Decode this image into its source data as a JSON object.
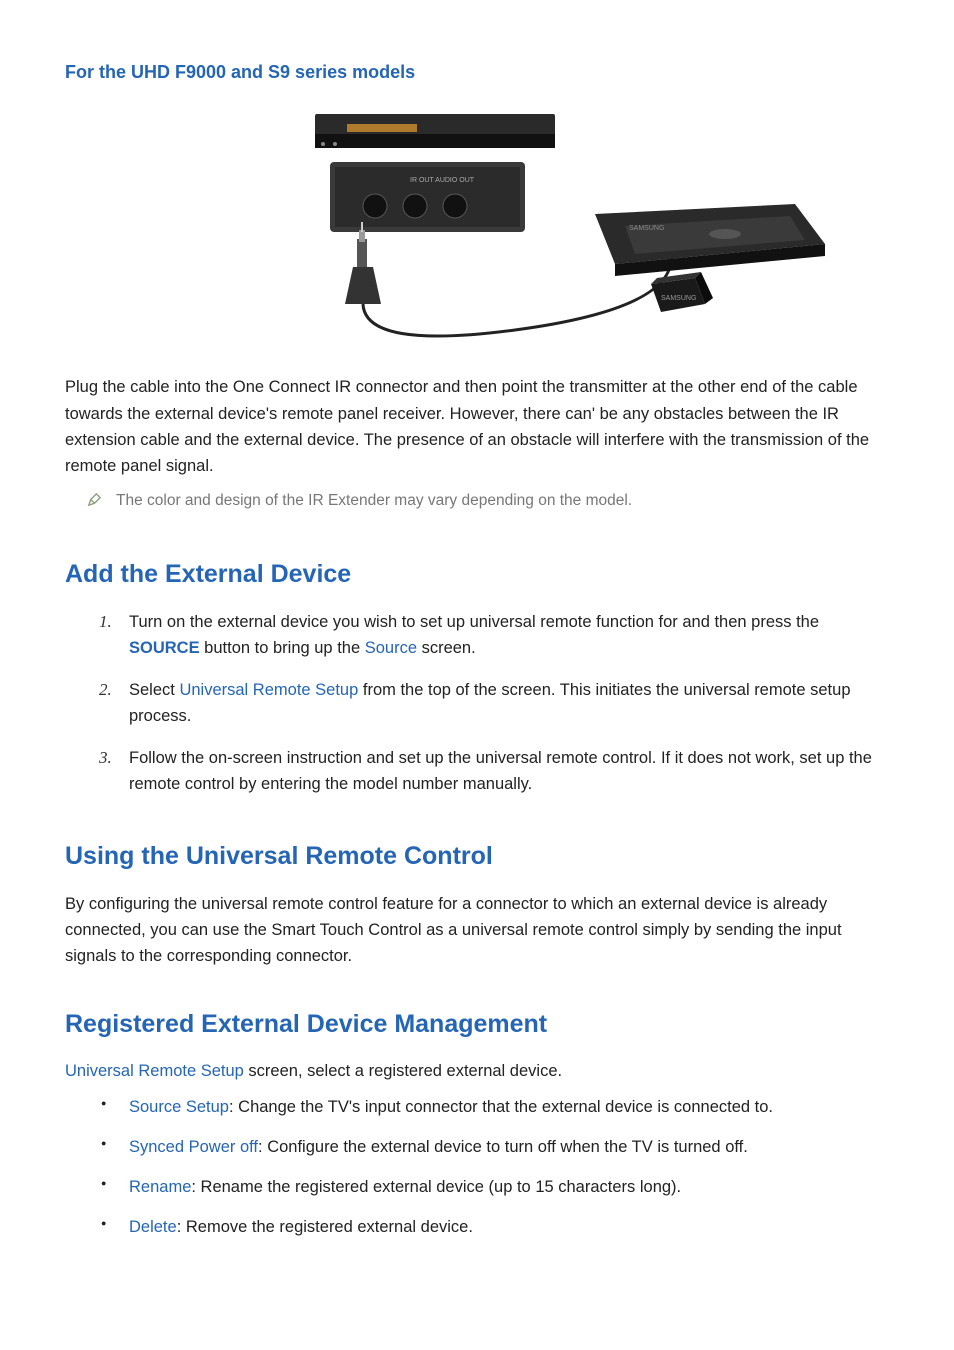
{
  "s1": {
    "heading": "For the UHD F9000 and S9 series models",
    "para": "Plug the cable into the One Connect IR connector and then point the transmitter at the other end of the cable towards the external device's remote panel receiver. However, there can' be any obstacles between the IR extension cable and the external device. The presence of an obstacle will interfere with the transmission of the remote panel signal.",
    "note": "The color and design of the IR Extender may vary depending on the model."
  },
  "s2": {
    "heading": "Add the External Device",
    "li1a": "Turn on the external device you wish to set up universal remote function for and then press the ",
    "li1_kw1": "SOURCE",
    "li1b": " button to bring up the ",
    "li1_kw2": "Source",
    "li1c": " screen.",
    "li2a": "Select ",
    "li2_kw": "Universal Remote Setup",
    "li2b": " from the top of the screen. This initiates the universal remote setup process.",
    "li3": "Follow the on-screen instruction and set up the universal remote control. If it does not work, set up the remote control by entering the model number manually."
  },
  "s3": {
    "heading": "Using the Universal Remote Control",
    "para": "By configuring the universal remote control feature for a connector to which an external device is already connected, you can use the Smart Touch Control as a universal remote control simply by sending the input signals to the corresponding connector."
  },
  "s4": {
    "heading": "Registered External Device Management",
    "intro_kw": "Universal Remote Setup",
    "intro_rest": " screen, select a registered external device.",
    "b1_kw": "Source Setup",
    "b1_rest": ": Change the TV's input connector that the external device is connected to.",
    "b2_kw": "Synced Power off",
    "b2_rest": ": Configure the external device to turn off when the TV is turned off.",
    "b3_kw": "Rename",
    "b3_rest": ": Rename the registered external device (up to 15 characters long).",
    "b4_kw": "Delete",
    "b4_rest": ": Remove the registered external device."
  }
}
